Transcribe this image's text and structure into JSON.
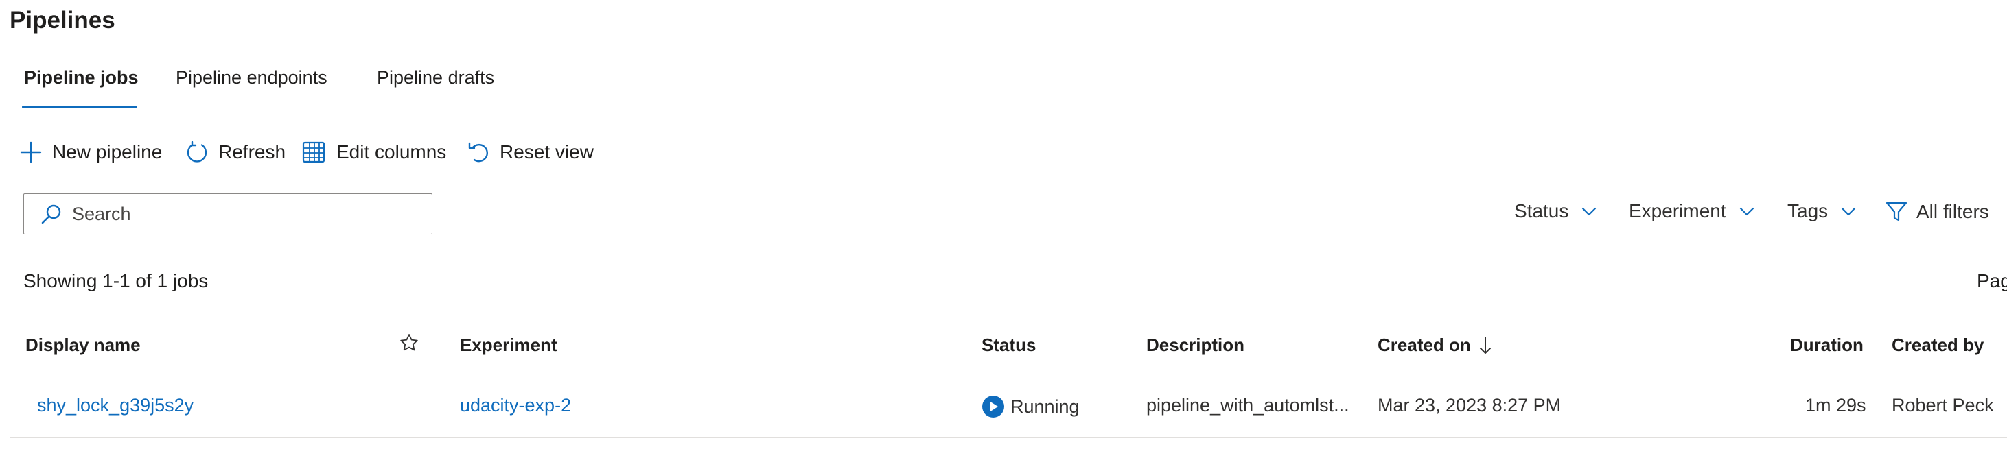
{
  "page": {
    "title": "Pipelines"
  },
  "tabs": [
    {
      "label": "Pipeline jobs",
      "active": true
    },
    {
      "label": "Pipeline endpoints",
      "active": false
    },
    {
      "label": "Pipeline drafts",
      "active": false
    }
  ],
  "toolbar": {
    "new_pipeline": "New pipeline",
    "refresh": "Refresh",
    "edit_columns": "Edit columns",
    "reset_view": "Reset view"
  },
  "search": {
    "placeholder": "Search"
  },
  "filters": {
    "status": "Status",
    "experiment": "Experiment",
    "tags": "Tags",
    "all_filters": "All filters"
  },
  "summary": {
    "count_text": "Showing 1-1 of 1 jobs",
    "pagination_text": "Pag"
  },
  "table": {
    "columns": [
      "Display name",
      "Experiment",
      "Status",
      "Description",
      "Created on",
      "Duration",
      "Created by"
    ],
    "rows": [
      {
        "display_name": "shy_lock_g39j5s2y",
        "experiment": "udacity-exp-2",
        "status": "Running",
        "description": "pipeline_with_automlst...",
        "created_on": "Mar 23, 2023 8:27 PM",
        "duration": "1m 29s",
        "created_by": "Robert Peck"
      }
    ]
  },
  "colors": {
    "accent": "#0f6cbd",
    "text": "#201f1e",
    "divider": "#e1dfdd"
  },
  "icons": [
    "plus-icon",
    "refresh-icon",
    "edit-columns-icon",
    "reset-icon",
    "search-icon",
    "chevron-down-icon",
    "filter-icon",
    "star-icon",
    "sort-down-icon",
    "running-icon"
  ]
}
